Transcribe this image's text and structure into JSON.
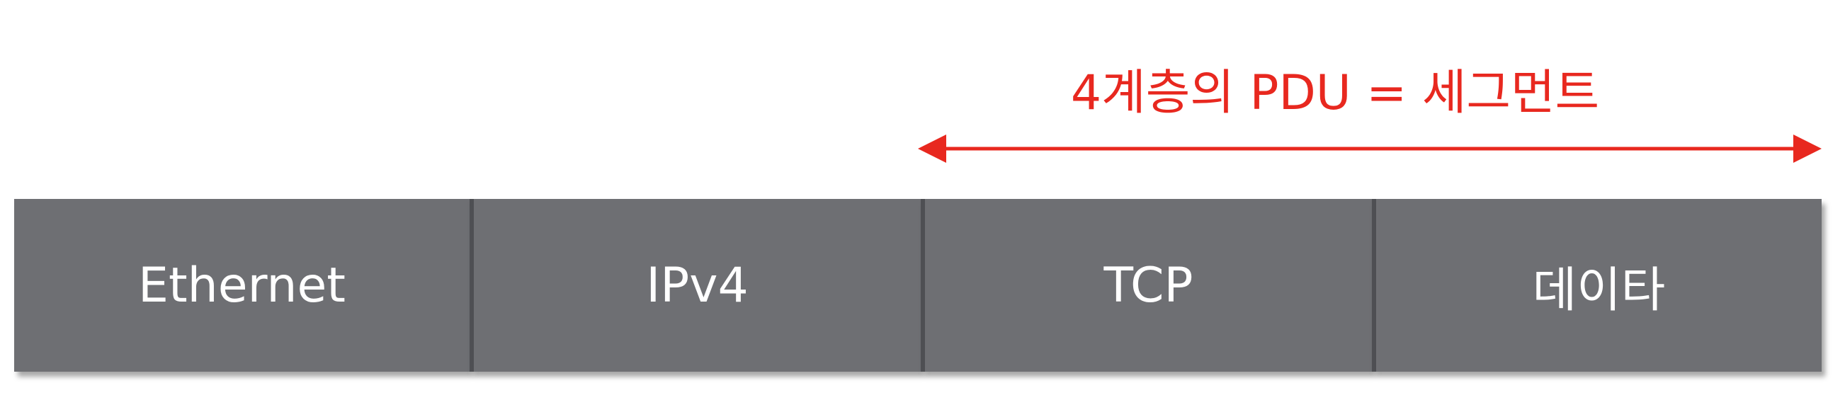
{
  "annotation": {
    "label": "4계층의 PDU = 세그먼트",
    "color": "#e8281f"
  },
  "pdu": {
    "cell_color": "#6e6f73",
    "cells": [
      {
        "label": "Ethernet"
      },
      {
        "label": "IPv4"
      },
      {
        "label": "TCP"
      },
      {
        "label": "데이타"
      }
    ]
  }
}
